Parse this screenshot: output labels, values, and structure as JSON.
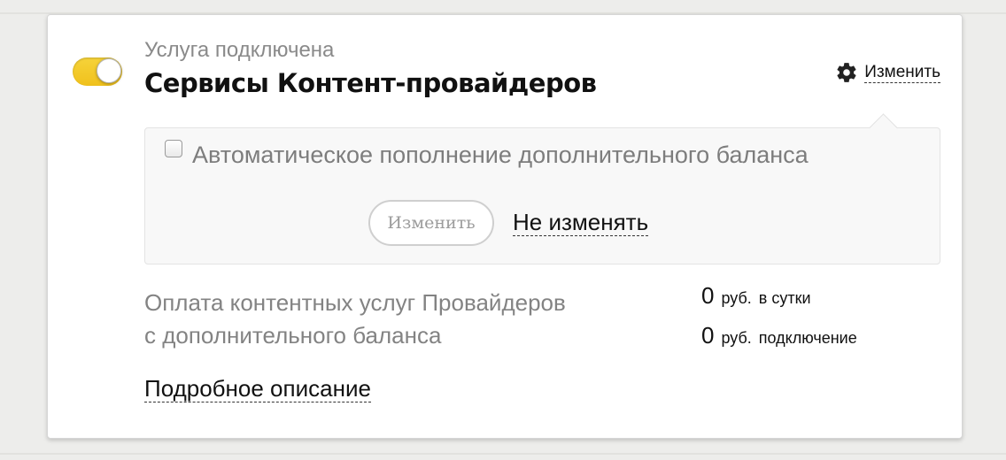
{
  "service": {
    "status": "Услуга подключена",
    "title": "Сервисы Контент-провайдеров",
    "enabled": true,
    "settings_label": "Изменить"
  },
  "popover": {
    "checkbox_label": "Автоматическое пополнение дополнительного баланса",
    "checked": false,
    "change_button": "Изменить",
    "no_change_link": "Не изменять"
  },
  "description": {
    "line1": "Оплата контентных услуг Провайдеров",
    "line2": "с дополнительного баланса"
  },
  "prices": [
    {
      "value": "0",
      "unit": "руб.",
      "note": "в сутки"
    },
    {
      "value": "0",
      "unit": "руб.",
      "note": "подключение"
    }
  ],
  "details_link": "Подробное описание",
  "colors": {
    "toggle_on": "#f0c11c",
    "text_muted": "#838383",
    "text_main": "#111111",
    "panel_bg": "#f8f8f8"
  }
}
